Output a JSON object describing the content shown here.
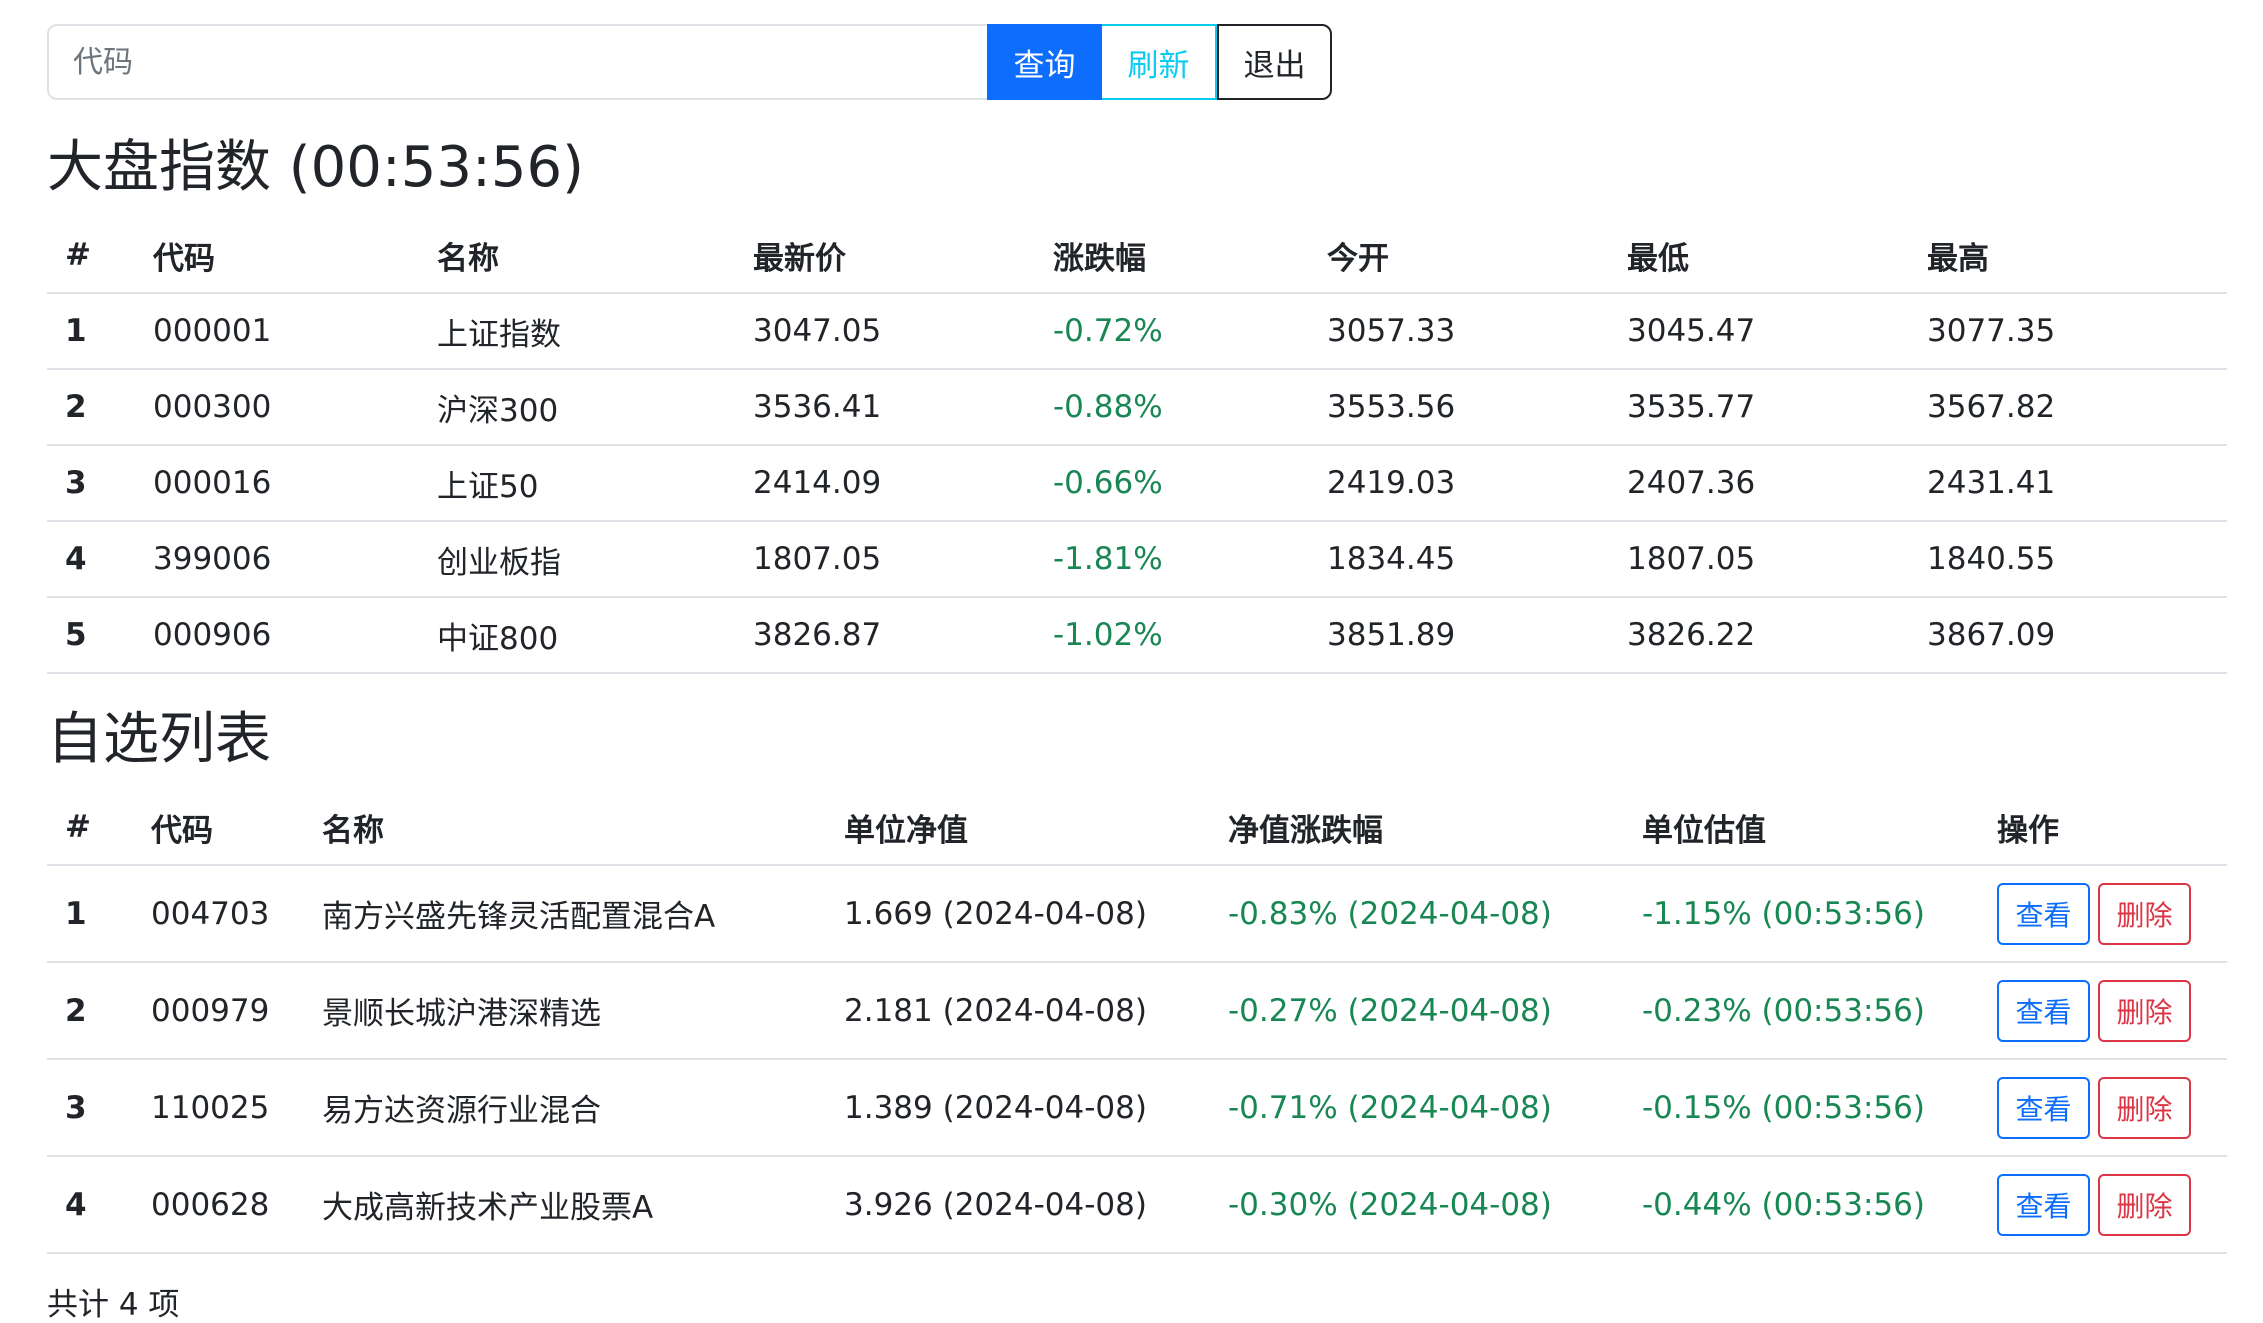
{
  "search": {
    "placeholder": "代码",
    "value": "",
    "query_label": "查询",
    "refresh_label": "刷新",
    "logout_label": "退出"
  },
  "index_section": {
    "title": "大盘指数 (00:53:56)",
    "columns": [
      "#",
      "代码",
      "名称",
      "最新价",
      "涨跌幅",
      "今开",
      "最低",
      "最高"
    ],
    "rows": [
      {
        "no": "1",
        "code": "000001",
        "name": "上证指数",
        "latest": "3047.05",
        "change": "-0.72%",
        "open": "3057.33",
        "low": "3045.47",
        "high": "3077.35"
      },
      {
        "no": "2",
        "code": "000300",
        "name": "沪深300",
        "latest": "3536.41",
        "change": "-0.88%",
        "open": "3553.56",
        "low": "3535.77",
        "high": "3567.82"
      },
      {
        "no": "3",
        "code": "000016",
        "name": "上证50",
        "latest": "2414.09",
        "change": "-0.66%",
        "open": "2419.03",
        "low": "2407.36",
        "high": "2431.41"
      },
      {
        "no": "4",
        "code": "399006",
        "name": "创业板指",
        "latest": "1807.05",
        "change": "-1.81%",
        "open": "1834.45",
        "low": "1807.05",
        "high": "1840.55"
      },
      {
        "no": "5",
        "code": "000906",
        "name": "中证800",
        "latest": "3826.87",
        "change": "-1.02%",
        "open": "3851.89",
        "low": "3826.22",
        "high": "3867.09"
      }
    ]
  },
  "watch_section": {
    "title": "自选列表",
    "columns": [
      "#",
      "代码",
      "名称",
      "单位净值",
      "净值涨跌幅",
      "单位估值",
      "操作"
    ],
    "view_label": "查看",
    "delete_label": "删除",
    "rows": [
      {
        "no": "1",
        "code": "004703",
        "name": "南方兴盛先锋灵活配置混合A",
        "nav": "1.669 (2024-04-08)",
        "nav_change": "-0.83% (2024-04-08)",
        "estimate": "-1.15% (00:53:56)"
      },
      {
        "no": "2",
        "code": "000979",
        "name": "景顺长城沪港深精选",
        "nav": "2.181 (2024-04-08)",
        "nav_change": "-0.27% (2024-04-08)",
        "estimate": "-0.23% (00:53:56)"
      },
      {
        "no": "3",
        "code": "110025",
        "name": "易方达资源行业混合",
        "nav": "1.389 (2024-04-08)",
        "nav_change": "-0.71% (2024-04-08)",
        "estimate": "-0.15% (00:53:56)"
      },
      {
        "no": "4",
        "code": "000628",
        "name": "大成高新技术产业股票A",
        "nav": "3.926 (2024-04-08)",
        "nav_change": "-0.30% (2024-04-08)",
        "estimate": "-0.44% (00:53:56)"
      }
    ],
    "footer": "共计 4 项"
  },
  "colors": {
    "primary": "#0d6efd",
    "info": "#0dcaf0",
    "dark": "#212529",
    "danger": "#dc3545",
    "down": "#198754",
    "border": "#dee2e6"
  }
}
